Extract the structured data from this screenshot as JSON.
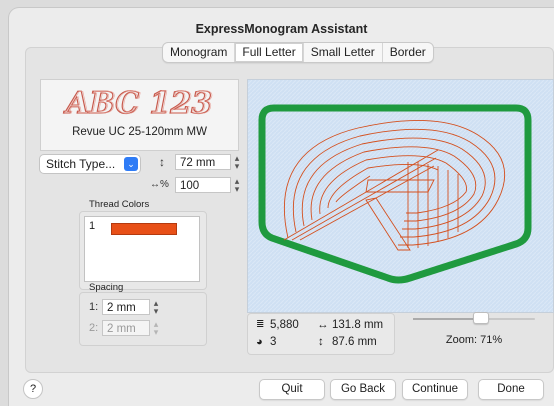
{
  "window": {
    "title": "ExpressMonogram Assistant"
  },
  "tabs": [
    {
      "label": "Monogram",
      "selected": false
    },
    {
      "label": "Full Letter",
      "selected": true
    },
    {
      "label": "Small Letter",
      "selected": false
    },
    {
      "label": "Border",
      "selected": false
    }
  ],
  "font_card": {
    "preview_text": "ABC 123",
    "name": "Revue UC 25-120mm MW"
  },
  "stitch_type": {
    "label": "Stitch Type..."
  },
  "size": {
    "height_value": "72 mm",
    "width_percent_value": "100",
    "height_icon": "↕",
    "width_icon": "↔%"
  },
  "thread_colors": {
    "title": "Thread Colors",
    "items": [
      {
        "number": "1",
        "color": "#e85018"
      }
    ]
  },
  "spacing": {
    "title": "Spacing",
    "rows": [
      {
        "label": "1:",
        "value": "2 mm",
        "enabled": true
      },
      {
        "label": "2:",
        "value": "2 mm",
        "enabled": false
      }
    ]
  },
  "stats": {
    "stitch_count": "5,880",
    "colors_count": "3",
    "width": "131.8 mm",
    "height": "87.6 mm",
    "icons": {
      "stitches": "stitch-count-icon",
      "colors": "palette-icon",
      "width": "↔",
      "height": "↕"
    }
  },
  "zoom": {
    "label": "Zoom: 71%",
    "level": 0.71
  },
  "colors": {
    "accent": "#2f7cf6",
    "thread": "#e85018",
    "border_green": "#1f9a3f",
    "preview_bg": "#cfe0f3"
  },
  "buttons": {
    "help": "?",
    "quit": "Quit",
    "go_back": "Go Back",
    "continue": "Continue",
    "done": "Done"
  }
}
